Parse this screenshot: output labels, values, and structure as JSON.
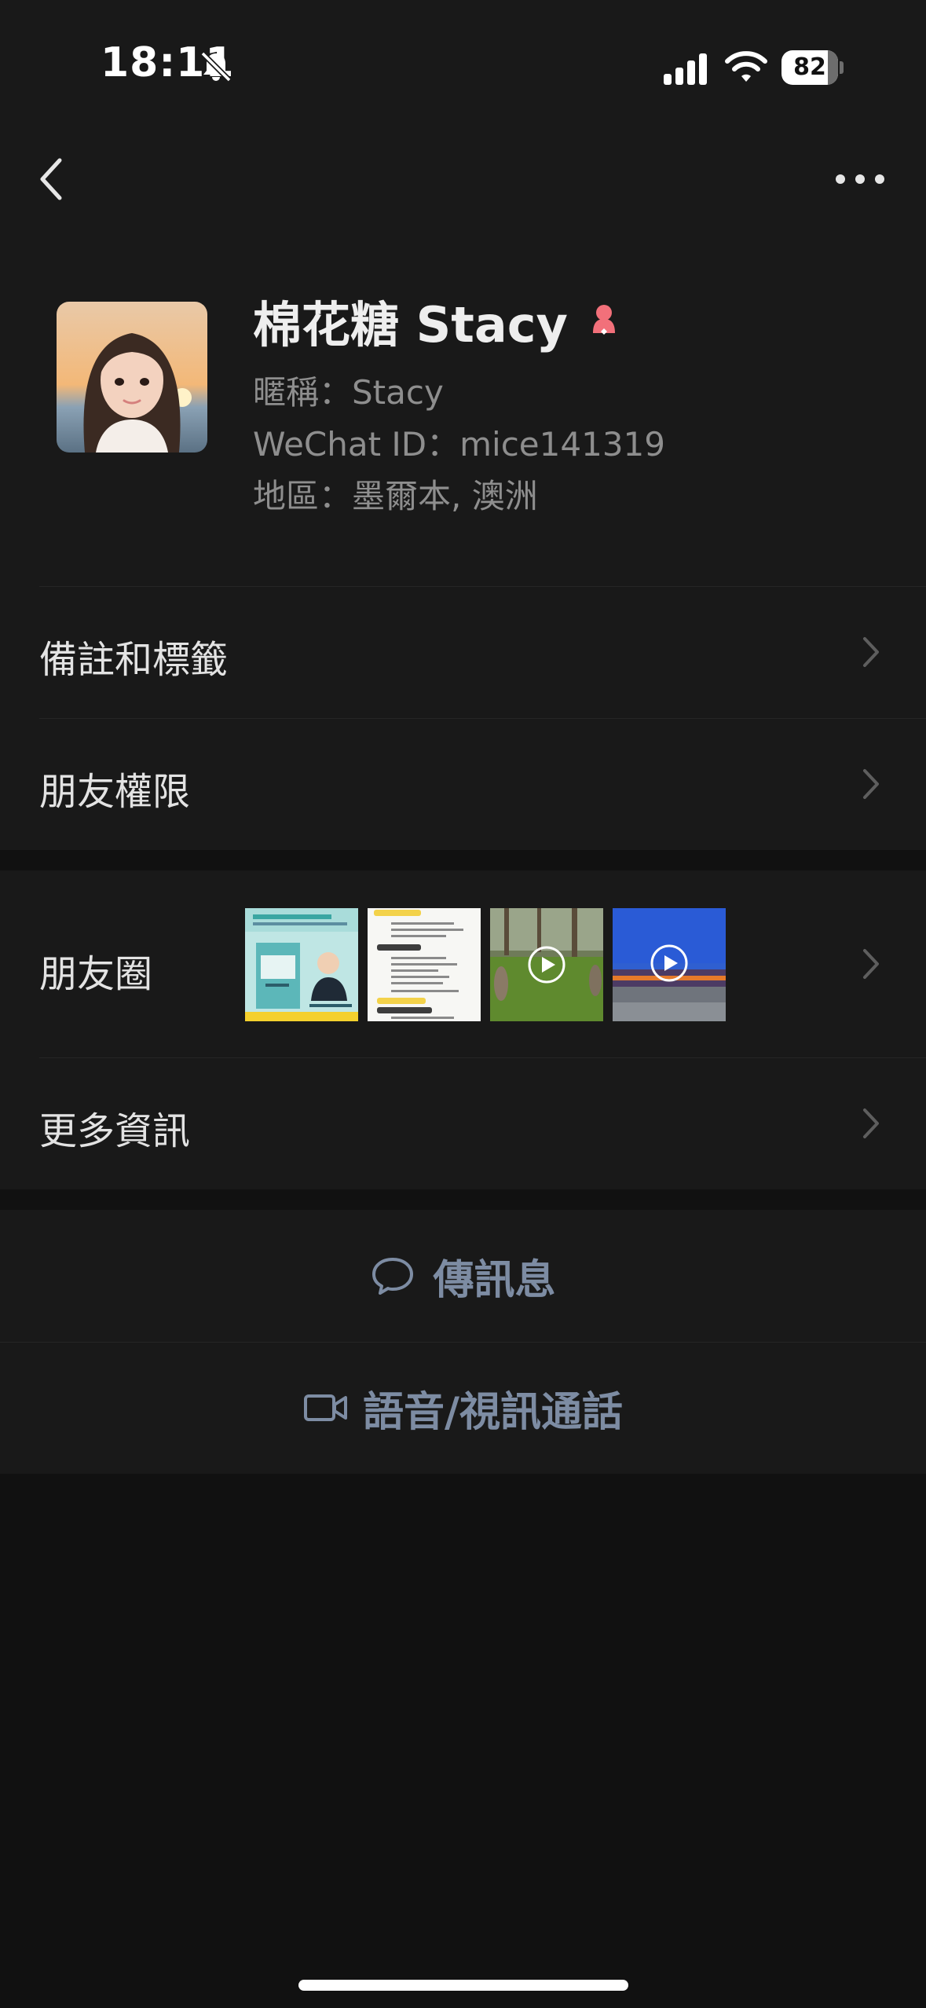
{
  "status_bar": {
    "time": "18:11",
    "battery": "82",
    "battery_level": 0.82,
    "icons": [
      "bell-slash-icon",
      "cellular-signal-icon",
      "wifi-icon",
      "battery-icon"
    ]
  },
  "nav": {
    "icons": [
      "chevron-left-icon",
      "more-dots-icon"
    ]
  },
  "profile": {
    "name": "棉花糖 Stacy",
    "nickname_line": "暱稱：Stacy",
    "wechat_id_line": "WeChat ID：mice141319",
    "region_line": "地區：墨爾本, 澳洲",
    "gender_icon": "female-icon",
    "gender_color": "#f2707a"
  },
  "rows": {
    "remarks_tags": "備註和標籤",
    "friend_permissions": "朋友權限",
    "moments": "朋友圈",
    "more_info": "更多資訊"
  },
  "actions": {
    "send_message": "傳訊息",
    "voice_video_call": "語音/視訊通話"
  },
  "colors": {
    "background": "#111111",
    "surface": "#191919",
    "action_text": "#7d8ca3",
    "secondary_text": "#8e8e8e"
  }
}
